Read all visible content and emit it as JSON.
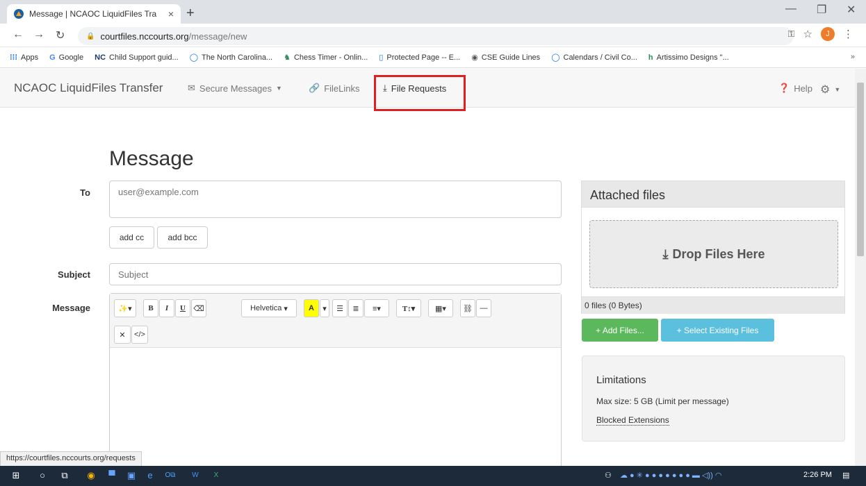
{
  "browser": {
    "tab_title": "Message | NCAOC LiquidFiles Tra",
    "tab_close": "×",
    "new_tab": "+",
    "url_host": "courtfiles.nccourts.org",
    "url_path": "/message/new",
    "profile_initial": "J"
  },
  "bookmarks": [
    {
      "icon": "apps",
      "label": "Apps"
    },
    {
      "icon": "google",
      "label": "Google"
    },
    {
      "icon": "nc",
      "label": "Child Support guid..."
    },
    {
      "icon": "globe",
      "label": "The North Carolina..."
    },
    {
      "icon": "chess",
      "label": "Chess Timer - Onlin..."
    },
    {
      "icon": "doc",
      "label": "Protected Page -- E..."
    },
    {
      "icon": "globe",
      "label": "CSE Guide Lines"
    },
    {
      "icon": "globe",
      "label": "Calendars / Civil Co..."
    },
    {
      "icon": "h",
      "label": "Artissimo Designs \"..."
    }
  ],
  "appnav": {
    "brand": "NCAOC LiquidFiles Transfer",
    "secure_messages": "Secure Messages",
    "filelinks": "FileLinks",
    "file_requests": "File Requests",
    "help": "Help"
  },
  "form": {
    "title": "Message",
    "to_label": "To",
    "to_placeholder": "user@example.com",
    "add_cc": "add cc",
    "add_bcc": "add bcc",
    "subject_label": "Subject",
    "subject_placeholder": "Subject",
    "message_label": "Message",
    "font_name": "Helvetica"
  },
  "attachments": {
    "title": "Attached files",
    "drop_label": "Drop Files Here",
    "count": "0 files (0 Bytes)",
    "add_files": "+ Add Files...",
    "select_existing": "+ Select Existing Files"
  },
  "limitations": {
    "title": "Limitations",
    "max_size": "Max size: 5 GB (Limit per message)",
    "blocked": "Blocked Extensions"
  },
  "status_url": "https://courtfiles.nccourts.org/requests",
  "taskbar": {
    "time": "2:26 PM"
  },
  "colors": {
    "highlight": "#e02020",
    "green": "#5cb85c",
    "blue": "#5bc0de"
  }
}
